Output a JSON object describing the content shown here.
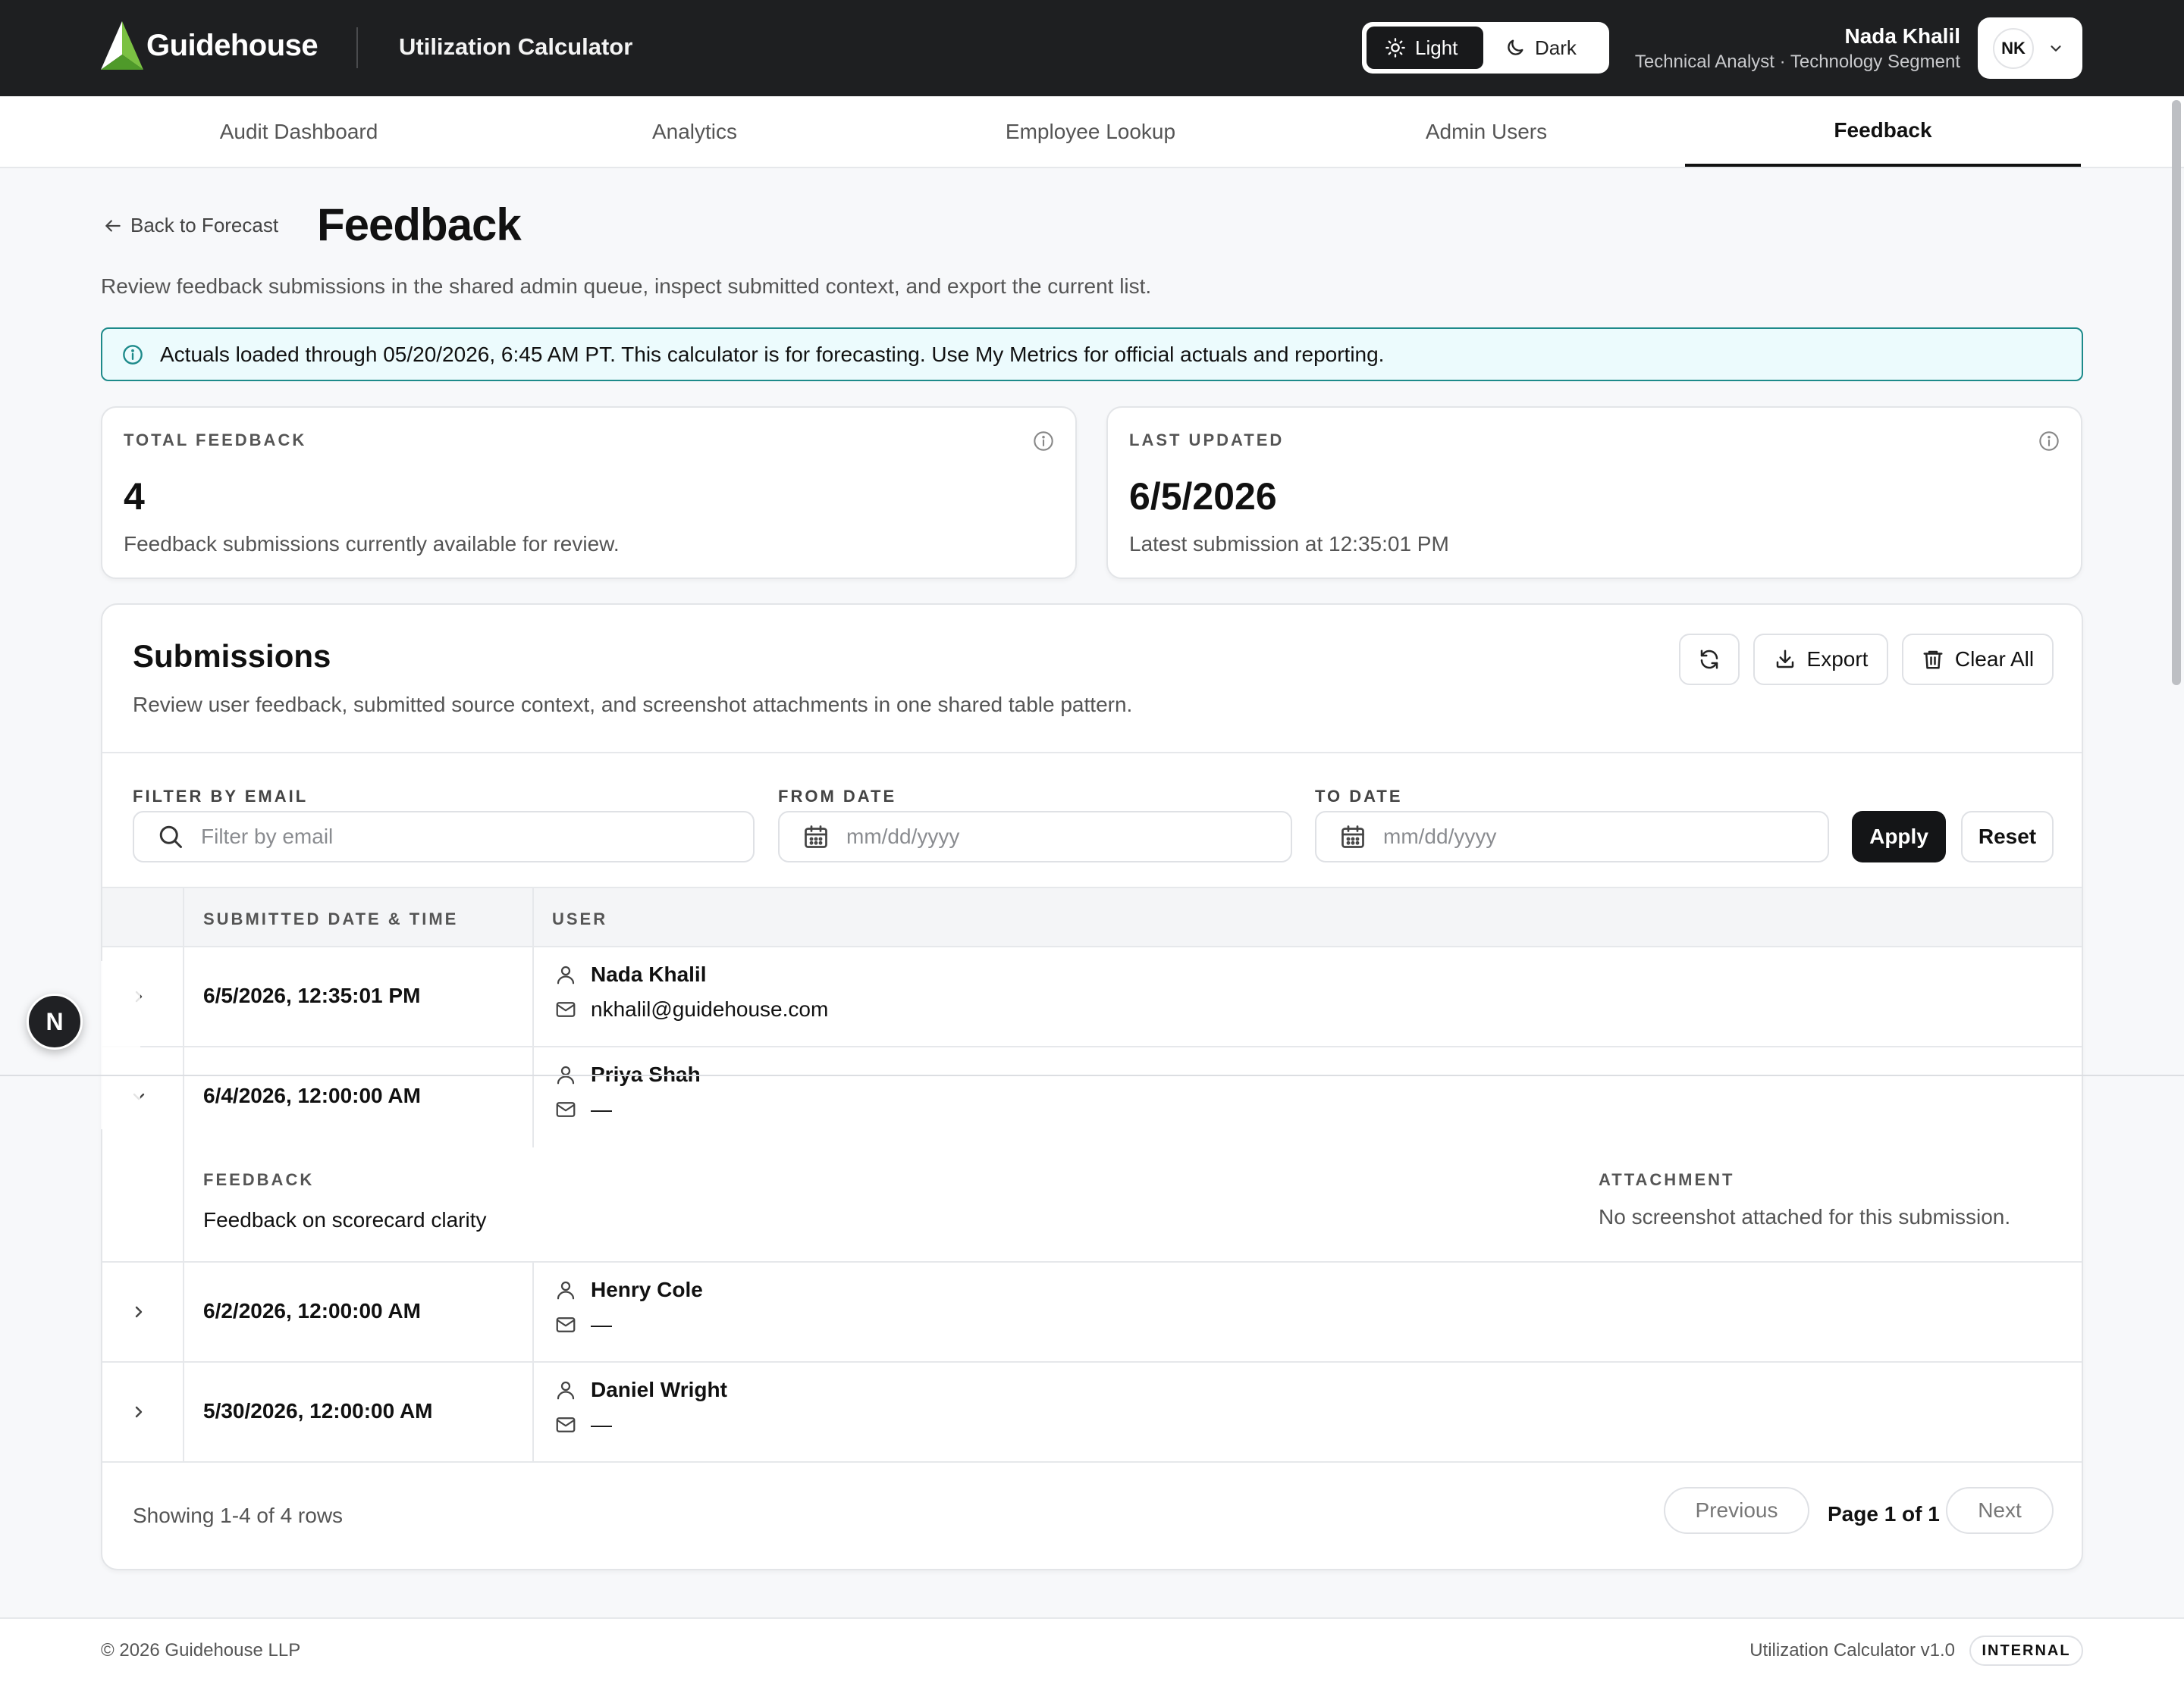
{
  "brand": {
    "logo_text": "Guidehouse",
    "app_title": "Utilization Calculator"
  },
  "theme": {
    "light_label": "Light",
    "dark_label": "Dark",
    "active": "Light"
  },
  "user": {
    "name": "Nada Khalil",
    "role": "Technical Analyst · Technology Segment",
    "initials": "NK"
  },
  "nav": {
    "tabs": [
      {
        "label": "Audit Dashboard"
      },
      {
        "label": "Analytics"
      },
      {
        "label": "Employee Lookup"
      },
      {
        "label": "Admin Users"
      },
      {
        "label": "Feedback"
      }
    ],
    "active": "Feedback"
  },
  "header": {
    "back_label": "Back to Forecast",
    "title": "Feedback",
    "description": "Review feedback submissions in the shared admin queue, inspect submitted context, and export the current list."
  },
  "alert": {
    "text": "Actuals loaded through 05/20/2026, 6:45 AM PT. This calculator is for forecasting. Use My Metrics for official actuals and reporting."
  },
  "stats": [
    {
      "label": "TOTAL FEEDBACK",
      "value": "4",
      "sub": "Feedback submissions currently available for review."
    },
    {
      "label": "LAST UPDATED",
      "value": "6/5/2026",
      "sub": "Latest submission at 12:35:01 PM"
    }
  ],
  "submissions": {
    "title": "Submissions",
    "description": "Review user feedback, submitted source context, and screenshot attachments in one shared table pattern.",
    "export_label": "Export",
    "clear_label": "Clear All",
    "filters": {
      "email_label": "FILTER BY EMAIL",
      "email_placeholder": "Filter by email",
      "from_label": "FROM DATE",
      "from_placeholder": "mm/dd/yyyy",
      "to_label": "TO DATE",
      "to_placeholder": "mm/dd/yyyy",
      "apply_label": "Apply",
      "reset_label": "Reset"
    },
    "columns": [
      "SUBMITTED DATE & TIME",
      "USER"
    ],
    "rows": [
      {
        "date": "6/5/2026, 12:35:01 PM",
        "user": "Nada Khalil",
        "email": "nkhalil@guidehouse.com"
      },
      {
        "date": "6/4/2026, 12:00:00 AM",
        "user": "Priya Shah",
        "email": "—"
      },
      {
        "date": "6/2/2026, 12:00:00 AM",
        "user": "Henry Cole",
        "email": "—"
      },
      {
        "date": "5/30/2026, 12:00:00 AM",
        "user": "Daniel Wright",
        "email": "—"
      }
    ],
    "expanded": {
      "feedback_label": "FEEDBACK",
      "feedback_text": "Feedback on scorecard clarity",
      "attachment_label": "ATTACHMENT",
      "attachment_text": "No screenshot attached for this submission."
    },
    "pagination": {
      "showing": "Showing 1-4 of 4 rows",
      "previous": "Previous",
      "page_info": "Page 1 of 1",
      "next": "Next"
    }
  },
  "floating_badge": "N",
  "footer": {
    "copyright": "© 2026 Guidehouse LLP",
    "version": "Utilization Calculator v1.0",
    "badge": "INTERNAL"
  }
}
